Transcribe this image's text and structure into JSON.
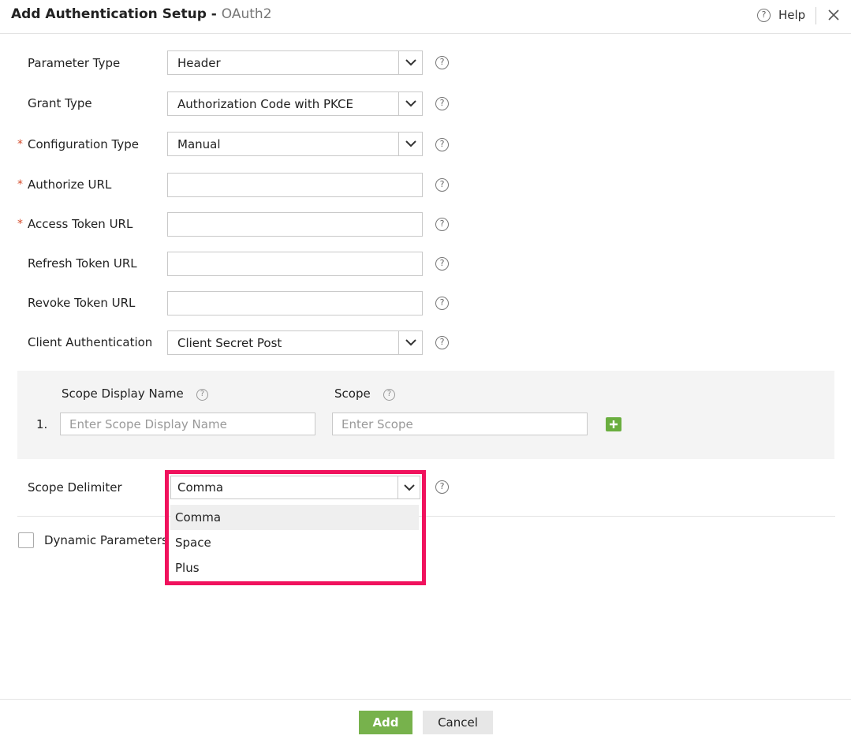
{
  "header": {
    "title": "Add Authentication Setup -",
    "subtitle": "OAuth2",
    "help_label": "Help"
  },
  "form": {
    "parameter_type": {
      "label": "Parameter Type",
      "value": "Header"
    },
    "grant_type": {
      "label": "Grant Type",
      "value": "Authorization Code with PKCE"
    },
    "configuration_type": {
      "label": "Configuration Type",
      "value": "Manual",
      "required_mark": "*"
    },
    "authorize_url": {
      "label": "Authorize URL",
      "value": "",
      "required_mark": "*"
    },
    "access_token_url": {
      "label": "Access Token URL",
      "value": "",
      "required_mark": "*"
    },
    "refresh_token_url": {
      "label": "Refresh Token URL",
      "value": ""
    },
    "revoke_token_url": {
      "label": "Revoke Token URL",
      "value": ""
    },
    "client_authentication": {
      "label": "Client Authentication",
      "value": "Client Secret Post"
    }
  },
  "scope": {
    "display_name_header": "Scope Display Name",
    "scope_header": "Scope",
    "rows": [
      {
        "index": "1.",
        "display_name_placeholder": "Enter Scope Display Name",
        "scope_placeholder": "Enter Scope"
      }
    ]
  },
  "scope_delimiter": {
    "label": "Scope Delimiter",
    "value": "Comma",
    "options": [
      "Comma",
      "Space",
      "Plus"
    ]
  },
  "dynamic_parameters": {
    "label": "Dynamic Parameters",
    "checked": false
  },
  "footer": {
    "add_label": "Add",
    "cancel_label": "Cancel"
  },
  "colors": {
    "accent_green": "#77b24c",
    "highlight": "#f0125d",
    "required": "#d54b2a"
  },
  "icons": [
    "question-icon",
    "close-icon",
    "chevron-down-icon",
    "plus-icon"
  ]
}
